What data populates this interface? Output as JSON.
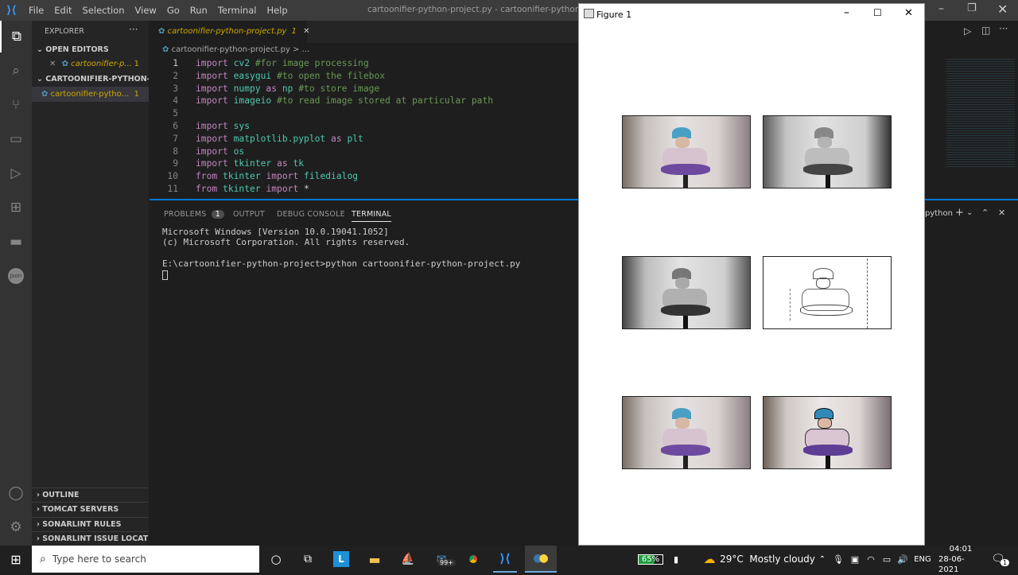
{
  "menu": [
    "File",
    "Edit",
    "Selection",
    "View",
    "Go",
    "Run",
    "Terminal",
    "Help"
  ],
  "window_title": "cartoonifier-python-project.py - cartoonifier-python-project",
  "explorer": {
    "title": "EXPLORER",
    "open_editors": "OPEN EDITORS",
    "open_file": "cartoonifier-p...",
    "open_badge": "1",
    "project": "CARTOONIFIER-PYTHON-P...",
    "project_file": "cartoonifier-pytho...",
    "project_badge": "1"
  },
  "sidebar_bottom": [
    "OUTLINE",
    "TOMCAT SERVERS",
    "SONARLINT RULES",
    "SONARLINT ISSUE LOCATIO..."
  ],
  "tab": {
    "label": "cartoonifier-python-project.py",
    "badge": "1"
  },
  "breadcrumb": "cartoonifier-python-project.py > ...",
  "code": [
    {
      "n": "1",
      "t": [
        [
          "kw",
          "import "
        ],
        [
          "mod",
          "cv2 "
        ],
        [
          "cm",
          "#for image processing"
        ]
      ]
    },
    {
      "n": "2",
      "t": [
        [
          "kw",
          "import "
        ],
        [
          "mod",
          "easygui "
        ],
        [
          "cm",
          "#to open the filebox"
        ]
      ]
    },
    {
      "n": "3",
      "t": [
        [
          "kw",
          "import "
        ],
        [
          "mod",
          "numpy "
        ],
        [
          "kw",
          "as "
        ],
        [
          "mod",
          "np "
        ],
        [
          "cm",
          "#to store image"
        ]
      ]
    },
    {
      "n": "4",
      "t": [
        [
          "kw",
          "import "
        ],
        [
          "mod",
          "imageio "
        ],
        [
          "cm",
          "#to read image stored at particular path"
        ]
      ]
    },
    {
      "n": "5",
      "t": []
    },
    {
      "n": "6",
      "t": [
        [
          "kw",
          "import "
        ],
        [
          "mod",
          "sys"
        ]
      ]
    },
    {
      "n": "7",
      "t": [
        [
          "kw",
          "import "
        ],
        [
          "mod",
          "matplotlib.pyplot "
        ],
        [
          "kw",
          "as "
        ],
        [
          "mod",
          "plt"
        ]
      ]
    },
    {
      "n": "8",
      "t": [
        [
          "kw",
          "import "
        ],
        [
          "mod",
          "os"
        ]
      ]
    },
    {
      "n": "9",
      "t": [
        [
          "kw",
          "import "
        ],
        [
          "mod",
          "tkinter "
        ],
        [
          "kw",
          "as "
        ],
        [
          "mod",
          "tk"
        ]
      ]
    },
    {
      "n": "10",
      "t": [
        [
          "kw",
          "from "
        ],
        [
          "mod",
          "tkinter "
        ],
        [
          "kw",
          "import "
        ],
        [
          "mod",
          "filedialog"
        ]
      ]
    },
    {
      "n": "11",
      "t": [
        [
          "kw",
          "from "
        ],
        [
          "mod",
          "tkinter "
        ],
        [
          "kw",
          "import "
        ],
        [
          "tx",
          "*"
        ]
      ]
    }
  ],
  "panel_tabs": [
    "PROBLEMS",
    "OUTPUT",
    "DEBUG CONSOLE",
    "TERMINAL"
  ],
  "problems_count": "1",
  "terminal_name": "python",
  "terminal_lines": [
    "Microsoft Windows [Version 10.0.19041.1052]",
    "(c) Microsoft Corporation. All rights reserved.",
    "",
    "E:\\cartoonifier-python-project>python cartoonifier-python-project.py"
  ],
  "figure": {
    "title": "Figure 1"
  },
  "taskbar": {
    "search_placeholder": "Type here to search",
    "mail_badge": "99+",
    "battery": "65%",
    "weather": "29°C  Mostly cloudy",
    "lang": "ENG",
    "time": "04:01",
    "date": "28-06-2021",
    "notif": "1"
  },
  "colors": {
    "accent": "#0078d4",
    "warning": "#cca700"
  }
}
